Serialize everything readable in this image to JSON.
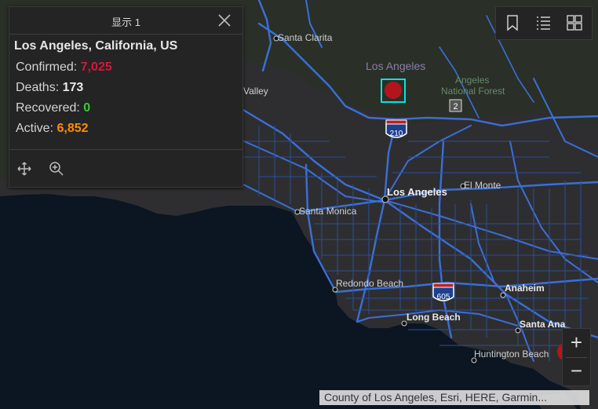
{
  "popup": {
    "title": "显示 1",
    "location": "Los Angeles, California, US",
    "stats": [
      {
        "label": "Confirmed:",
        "value": "7,025",
        "color": "#dc143c"
      },
      {
        "label": "Deaths:",
        "value": "173",
        "color": "#e8e8e8"
      },
      {
        "label": "Recovered:",
        "value": "0",
        "color": "#32cd32"
      },
      {
        "label": "Active:",
        "value": "6,852",
        "color": "#ff8c00"
      }
    ],
    "actions": [
      "pan-icon",
      "zoom-to-icon"
    ]
  },
  "toolbar": {
    "icons": [
      "bookmark-icon",
      "layer-list-icon",
      "basemap-gallery-icon"
    ]
  },
  "zoom": {
    "in": "+",
    "out": "−"
  },
  "attribution": "County of Los Angeles, Esri, HERE, Garmin...",
  "map_labels": {
    "santa_clarita": "Santa Clarita",
    "los_angeles_region": "Los Angeles",
    "angeles_nf_1": "Angeles",
    "angeles_nf_2": "National Forest",
    "valley": "Valley",
    "los_angeles": "Los Angeles",
    "el_monte": "El Monte",
    "santa_monica": "Santa Monica",
    "redondo_beach": "Redondo Beach",
    "anaheim": "Anaheim",
    "long_beach": "Long Beach",
    "santa_ana": "Santa Ana",
    "huntington_beach": "Huntington Beach",
    "shield_210": "210",
    "shield_605": "605",
    "shield_2": "2"
  },
  "colors": {
    "ocean": "#0b1622",
    "land": "#2e2e30",
    "mountain": "#2a2f28",
    "road": "#3a6fd8",
    "marker": "#b2161c",
    "highlight": "#00e5e5"
  }
}
